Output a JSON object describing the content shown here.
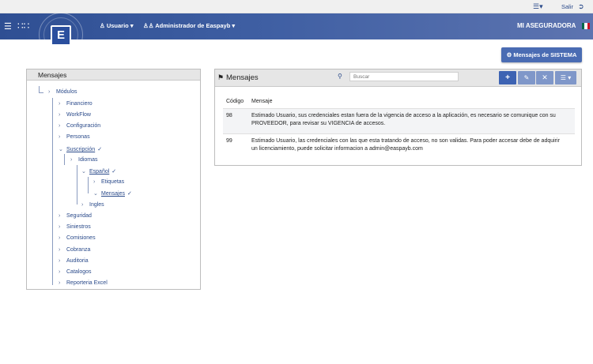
{
  "topbar": {
    "help_icon": "help-icon",
    "logout_label": "Salir",
    "logout_icon": "logout-icon"
  },
  "navbar": {
    "user_label": "Usuario",
    "admin_label": "Administrador de Easpayb",
    "company": "MI ASEGURADORA",
    "logo_letter": "E",
    "flag_colors": [
      "#006847",
      "#ffffff",
      "#ce1126"
    ]
  },
  "actions": {
    "system_messages_button": "Mensajes de SISTEMA"
  },
  "tree": {
    "title": "Mensajes",
    "items": [
      {
        "label": "Módulos"
      },
      {
        "label": "Financiero"
      },
      {
        "label": "WorkFlow"
      },
      {
        "label": "Configuración"
      },
      {
        "label": "Personas"
      },
      {
        "label": "Suscripción"
      },
      {
        "label": "Idiomas"
      },
      {
        "label": "Español"
      },
      {
        "label": "Etiquetas"
      },
      {
        "label": "Mensajes"
      },
      {
        "label": "Ingles"
      },
      {
        "label": "Seguridad"
      },
      {
        "label": "Siniestros"
      },
      {
        "label": "Comisiones"
      },
      {
        "label": "Cobranza"
      },
      {
        "label": "Auditoria"
      },
      {
        "label": "Catalogos"
      },
      {
        "label": "Reporteria Excel"
      }
    ]
  },
  "messages": {
    "title": "Mensajes",
    "search_placeholder": "Buscar",
    "columns": [
      "Código",
      "Mensaje"
    ],
    "rows": [
      {
        "code": "98",
        "line1": "Estimado Usuario, sus credenciales estan fuera de la vigencia de acceso a la aplicación, es necesario se comunique con su",
        "line2": "PROVEEDOR, para revisar su VIGENCIA de accesos."
      },
      {
        "code": "99",
        "line1": "Estimado Usuario, las credenciales con las que esta tratando de acceso, no son validas. Para poder accesar debe de adquirir",
        "line2": "un licenciamiento, puede solicitar informacion a admin@easpayb.com"
      }
    ]
  }
}
